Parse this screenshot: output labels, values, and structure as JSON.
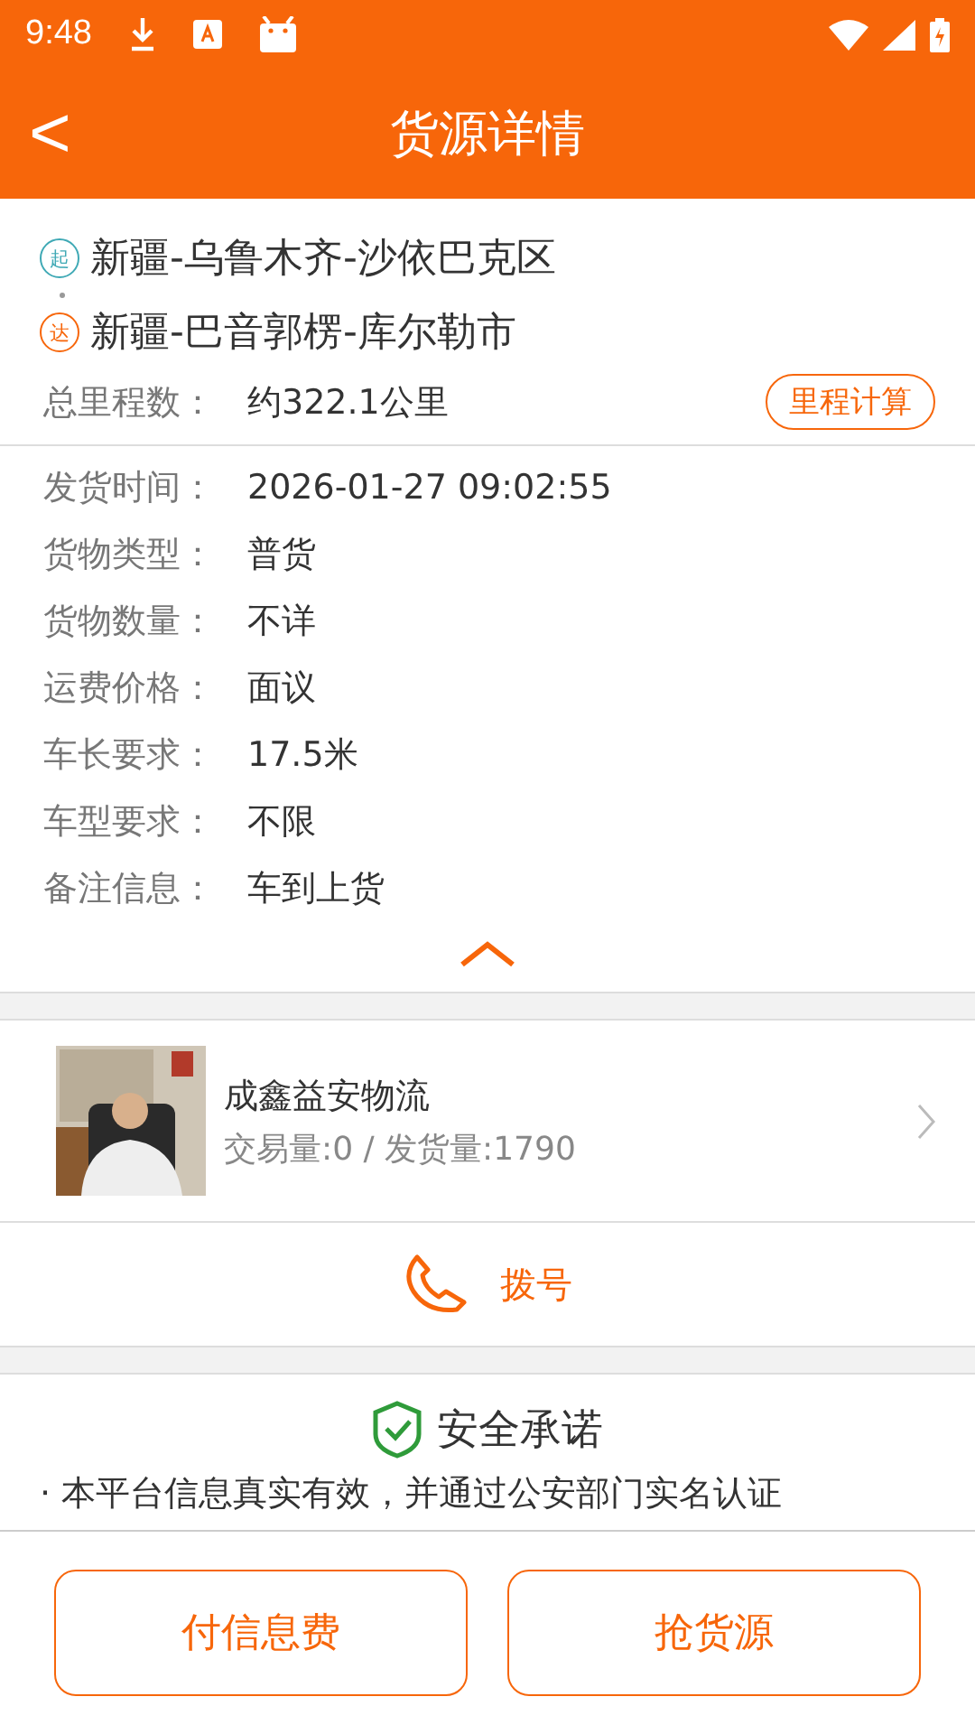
{
  "status_bar": {
    "time": "9:48"
  },
  "header": {
    "back": "<",
    "title": "货源详情"
  },
  "route": {
    "from_tag": "起",
    "from": "新疆-乌鲁木齐-沙依巴克区",
    "to_tag": "达",
    "to": "新疆-巴音郭楞-库尔勒市"
  },
  "distance": {
    "label": "总里程数：",
    "value": "约322.1公里",
    "button": "里程计算"
  },
  "details": [
    {
      "label": "发货时间：",
      "value": "2026-01-27 09:02:55"
    },
    {
      "label": "货物类型：",
      "value": "普货"
    },
    {
      "label": "货物数量：",
      "value": "不详"
    },
    {
      "label": "运费价格：",
      "value": "面议"
    },
    {
      "label": "车长要求：",
      "value": "17.5米"
    },
    {
      "label": "车型要求：",
      "value": "不限"
    },
    {
      "label": "备注信息：",
      "value": "车到上货"
    }
  ],
  "details_expanded": true,
  "shipper": {
    "name": "成鑫益安物流",
    "stats": "交易量:0 / 发货量:1790"
  },
  "dial": {
    "label": "拨号"
  },
  "safety": {
    "title": "安全承诺",
    "text": "· 本平台信息真实有效，并通过公安部门实名认证"
  },
  "actions": [
    "付信息费",
    "抢货源"
  ]
}
